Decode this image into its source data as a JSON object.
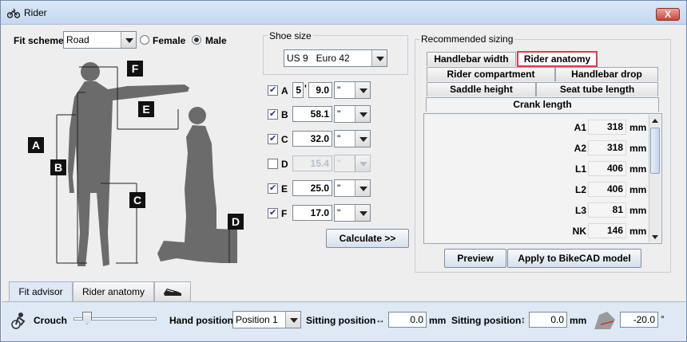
{
  "window": {
    "title": "Rider",
    "close": "X"
  },
  "fit": {
    "scheme_label": "Fit scheme",
    "scheme_value": "Road",
    "female_label": "Female",
    "male_label": "Male",
    "gender_selected": "Male"
  },
  "diagram": {
    "letters": [
      "A",
      "B",
      "C",
      "D",
      "E",
      "F"
    ]
  },
  "shoe": {
    "group_label": "Shoe size",
    "value": "US 9   Euro 42"
  },
  "measurements": [
    {
      "letter": "A",
      "checked": true,
      "feet": "5",
      "ft_mark": "'",
      "value": "9.0",
      "unit": "\""
    },
    {
      "letter": "B",
      "checked": true,
      "value": "58.1",
      "unit": "\""
    },
    {
      "letter": "C",
      "checked": true,
      "value": "32.0",
      "unit": "\""
    },
    {
      "letter": "D",
      "checked": false,
      "value": "15.4",
      "unit": "\""
    },
    {
      "letter": "E",
      "checked": true,
      "value": "25.0",
      "unit": "\""
    },
    {
      "letter": "F",
      "checked": true,
      "value": "17.0",
      "unit": "\""
    }
  ],
  "calculate_label": "Calculate >>",
  "recommended": {
    "group_label": "Recommended sizing",
    "tabs": [
      "Handlebar width",
      "Rider anatomy",
      "Rider compartment",
      "Handlebar drop",
      "Saddle height",
      "Seat tube length",
      "Crank length"
    ],
    "selected_tab": "Rider anatomy",
    "rows": [
      {
        "name": "A1",
        "value": "318",
        "unit": "mm"
      },
      {
        "name": "A2",
        "value": "318",
        "unit": "mm"
      },
      {
        "name": "L1",
        "value": "406",
        "unit": "mm"
      },
      {
        "name": "L2",
        "value": "406",
        "unit": "mm"
      },
      {
        "name": "L3",
        "value": "81",
        "unit": "mm"
      },
      {
        "name": "NK",
        "value": "146",
        "unit": "mm"
      }
    ],
    "preview_label": "Preview",
    "apply_label": "Apply to BikeCAD model"
  },
  "bottom_tabs": [
    "Fit advisor",
    "Rider anatomy",
    "shoe-icon"
  ],
  "bottom": {
    "crouch_label": "Crouch",
    "crouch_level": 0.12,
    "hand_label": "Hand position",
    "hand_value": "Position 1",
    "sit_h_label": "Sitting position",
    "sit_h_arrow": "↔",
    "sit_h_value": "0.0",
    "sit_h_unit": "mm",
    "sit_v_label": "Sitting position",
    "sit_v_arrow": "↕",
    "sit_v_value": "0.0",
    "sit_v_unit": "mm",
    "angle_value": "-20.0",
    "angle_unit": "°"
  },
  "colors": {
    "accent_tab_outline": "#e23a4a",
    "silhouette": "#6b6b6b",
    "frame": "#6d8bb0"
  }
}
